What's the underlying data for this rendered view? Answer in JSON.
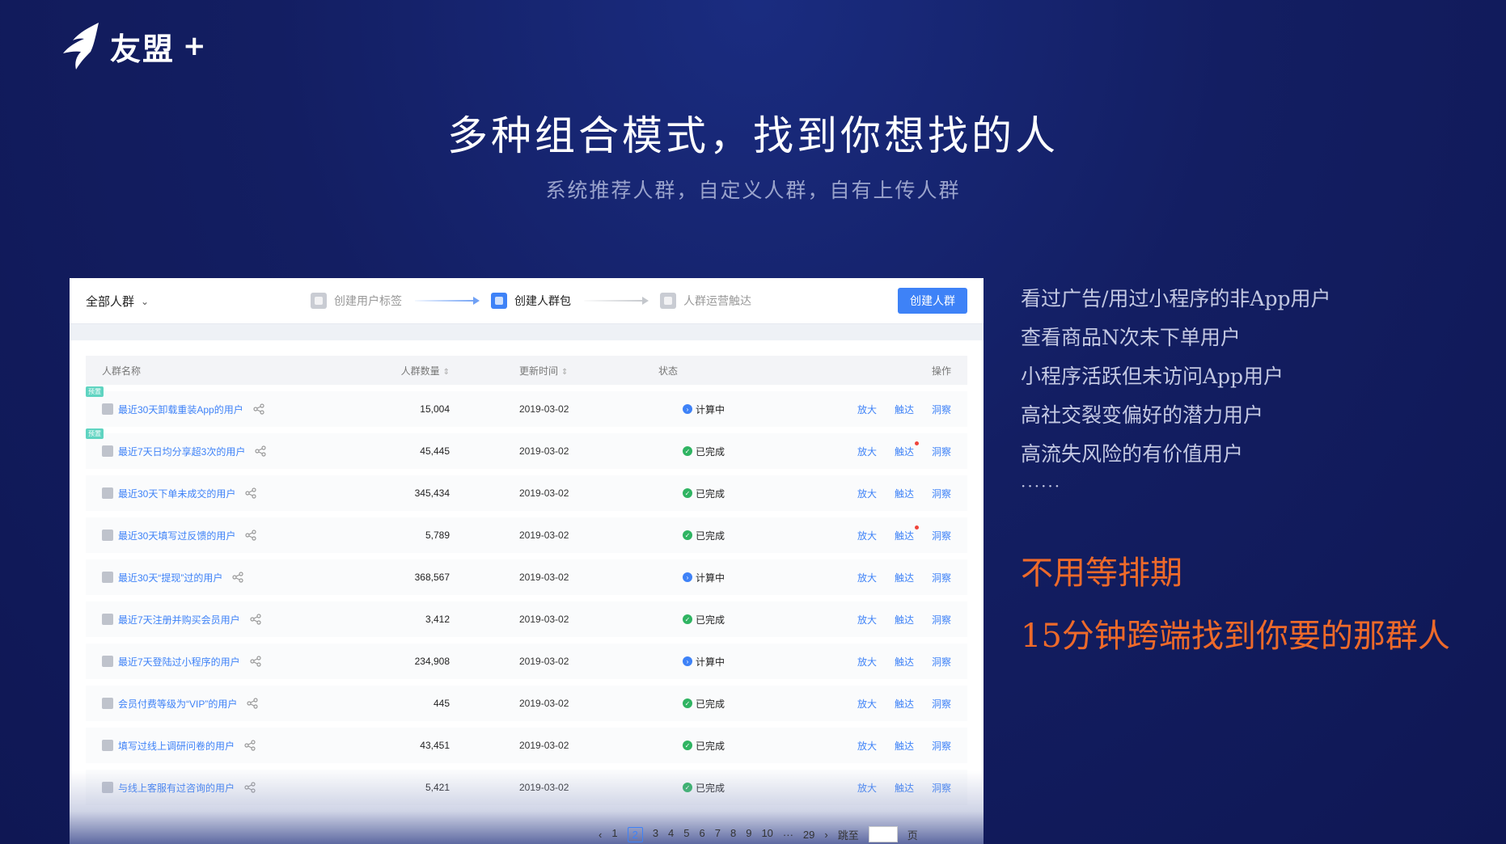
{
  "brand": {
    "name": "友盟",
    "plus": "+"
  },
  "hero": {
    "title": "多种组合模式，找到你想找的人",
    "subtitle": "系统推荐人群，自定义人群，自有上传人群"
  },
  "app": {
    "dropdown_label": "全部人群",
    "steps": [
      {
        "label": "创建用户标签",
        "active": false
      },
      {
        "label": "创建人群包",
        "active": true
      },
      {
        "label": "人群运营触达",
        "active": false
      }
    ],
    "create_button": "创建人群",
    "table": {
      "headers": {
        "name": "人群名称",
        "count": "人群数量",
        "updated": "更新时间",
        "status": "状态",
        "ops": "操作"
      },
      "sort_glyph": "⇕",
      "rows": [
        {
          "tag": "预置",
          "name": "最近30天卸载重装App的用户",
          "count": "15,004",
          "date": "2019-03-02",
          "status": "计算中",
          "status_type": "calc",
          "reddot": false
        },
        {
          "tag": "预置",
          "name": "最近7天日均分享超3次的用户",
          "count": "45,445",
          "date": "2019-03-02",
          "status": "已完成",
          "status_type": "done",
          "reddot": true
        },
        {
          "tag": "",
          "name": "最近30天下单未成交的用户",
          "count": "345,434",
          "date": "2019-03-02",
          "status": "已完成",
          "status_type": "done",
          "reddot": false
        },
        {
          "tag": "",
          "name": "最近30天填写过反馈的用户",
          "count": "5,789",
          "date": "2019-03-02",
          "status": "已完成",
          "status_type": "done",
          "reddot": true
        },
        {
          "tag": "",
          "name": "最近30天“提现”过的用户",
          "count": "368,567",
          "date": "2019-03-02",
          "status": "计算中",
          "status_type": "calc",
          "reddot": false
        },
        {
          "tag": "",
          "name": "最近7天注册并购买会员用户",
          "count": "3,412",
          "date": "2019-03-02",
          "status": "已完成",
          "status_type": "done",
          "reddot": false
        },
        {
          "tag": "",
          "name": "最近7天登陆过小程序的用户",
          "count": "234,908",
          "date": "2019-03-02",
          "status": "计算中",
          "status_type": "calc",
          "reddot": false
        },
        {
          "tag": "",
          "name": "会员付费等级为“VIP”的用户",
          "count": "445",
          "date": "2019-03-02",
          "status": "已完成",
          "status_type": "done",
          "reddot": false
        },
        {
          "tag": "",
          "name": "填写过线上调研问卷的用户",
          "count": "43,451",
          "date": "2019-03-02",
          "status": "已完成",
          "status_type": "done",
          "reddot": false
        },
        {
          "tag": "",
          "name": "与线上客服有过咨询的用户",
          "count": "5,421",
          "date": "2019-03-02",
          "status": "已完成",
          "status_type": "done",
          "reddot": false
        }
      ],
      "ops": [
        "放大",
        "触达",
        "洞察"
      ]
    },
    "pager": {
      "prev": "‹",
      "next": "›",
      "pages": [
        "1",
        "2",
        "3",
        "4",
        "5",
        "6",
        "7",
        "8",
        "9",
        "10"
      ],
      "current": "2",
      "ellipsis": "···",
      "last": "29",
      "jump_label": "跳至",
      "page_unit": "页"
    }
  },
  "right": {
    "items": [
      "看过广告/用过小程序的非App用户",
      "查看商品N次未下单用户",
      "小程序活跃但未访问App用户",
      "高社交裂变偏好的潜力用户",
      "高流失风险的有价值用户"
    ],
    "dots": "······",
    "promo1": "不用等排期",
    "promo2": "15分钟跨端找到你要的那群人"
  },
  "colors": {
    "accent": "#3e82f7",
    "promo": "#ee6a2a",
    "done": "#2fb462",
    "background": "#131e62"
  }
}
